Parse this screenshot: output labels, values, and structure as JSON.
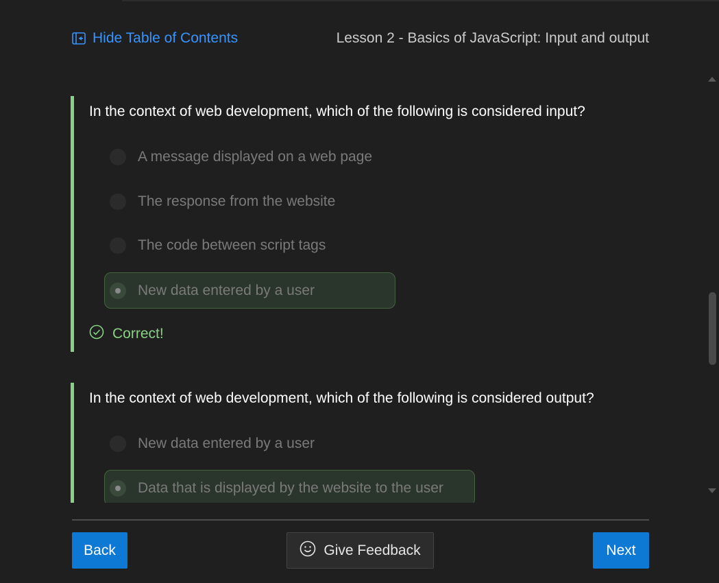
{
  "header": {
    "toc_toggle_label": "Hide Table of Contents",
    "lesson_title": "Lesson 2 - Basics of JavaScript: Input and output"
  },
  "questions": [
    {
      "text": "In the context of web development, which of the following is considered input?",
      "options": [
        {
          "label": "A message displayed on a web page",
          "selected": false
        },
        {
          "label": "The response from the website",
          "selected": false
        },
        {
          "label": "The code between script tags",
          "selected": false
        },
        {
          "label": "New data entered by a user",
          "selected": true
        }
      ],
      "result": "Correct!"
    },
    {
      "text": "In the context of web development, which of the following is considered output?",
      "options": [
        {
          "label": "New data entered by a user",
          "selected": false
        },
        {
          "label": "Data that is displayed by the website to the user",
          "selected": true
        }
      ]
    }
  ],
  "footer": {
    "back_label": "Back",
    "feedback_label": "Give Feedback",
    "next_label": "Next"
  },
  "colors": {
    "background": "#1f1f1f",
    "accent_blue": "#0e78d5",
    "link_blue": "#3794ff",
    "success_green": "#89d185"
  },
  "icons": {
    "toc": "toc-collapse-icon",
    "result": "check-circle-icon",
    "feedback": "smiley-icon"
  }
}
